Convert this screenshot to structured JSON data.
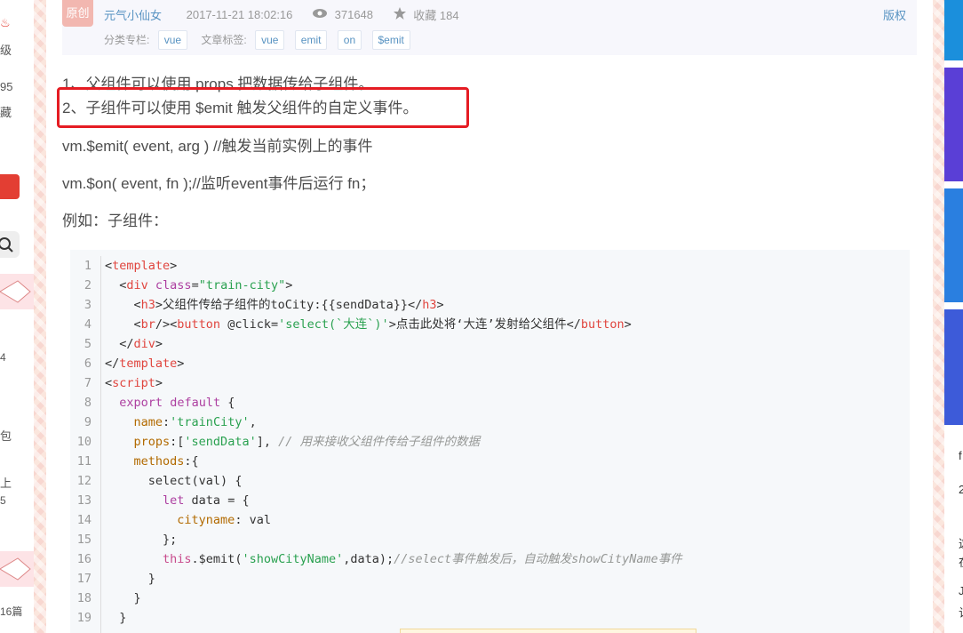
{
  "left_sidebar": {
    "texts": [
      "级",
      "95",
      "藏",
      "4",
      "包",
      "上",
      "5",
      "16篇"
    ]
  },
  "article_info": {
    "badge": "原创",
    "author": "元气小仙女",
    "date": "2017-11-21 18:02:16",
    "views": "371648",
    "favorites": "收藏 184",
    "copyright": "版权",
    "category_label": "分类专栏:",
    "category_tag": "vue",
    "article_tags_label": "文章标签:",
    "article_tags": [
      "vue",
      "emit",
      "on",
      "$emit"
    ]
  },
  "content": {
    "para1": "1、父组件可以使用 props 把数据传给子组件。",
    "para2": "2、子组件可以使用 $emit 触发父组件的自定义事件。",
    "para3": "vm.$emit( event, arg ) //触发当前实例上的事件",
    "para4": "vm.$on( event, fn );//监听event事件后运行 fn；",
    "para5": "例如：子组件："
  },
  "code": {
    "line_numbers": [
      "1",
      "2",
      "3",
      "4",
      "5",
      "6",
      "7",
      "8",
      "9",
      "10",
      "11",
      "12",
      "13",
      "14",
      "15",
      "16",
      "17",
      "18",
      "19"
    ],
    "l1_tag": "template",
    "l2_tag": "div",
    "l2_attr": "class",
    "l2_val": "\"train-city\"",
    "l3_tag": "h3",
    "l3_text": "父组件传给子组件的toCity:{{sendData}}",
    "l4_br": "br",
    "l4_btn": "button",
    "l4_attr": "@click",
    "l4_val": "'select(`大连`)'",
    "l4_text": "点击此处将‘大连’发射给父组件",
    "l5_tag": "div",
    "l6_tag": "template",
    "l7_tag": "script",
    "l8_kw1": "export",
    "l8_kw2": "default",
    "l9_prop": "name",
    "l9_str": "'trainCity'",
    "l10_prop": "props",
    "l10_str": "'sendData'",
    "l10_cmt": "// 用来接收父组件传给子组件的数据",
    "l11_prop": "methods",
    "l12_text": "select(val) {",
    "l13_kw": "let",
    "l13_text": " data = {",
    "l14_prop": "cityname",
    "l14_text": " val",
    "l15_text": "};",
    "l16_this": "this",
    "l16_call": ".$emit(",
    "l16_str": "'showCityName'",
    "l16_args": ",data);",
    "l16_cmt": "//select事件触发后，自动触发showCityName事件",
    "l17_text": "}",
    "l18_text": "}",
    "l19_text": "}"
  },
  "right_sidebar": {
    "texts": [
      "f",
      "2",
      "这",
      "在",
      "J",
      "认"
    ]
  },
  "colors": {
    "highlight_box": "#e51c23",
    "link": "#5893c2",
    "badge": "#f2b7b0"
  }
}
